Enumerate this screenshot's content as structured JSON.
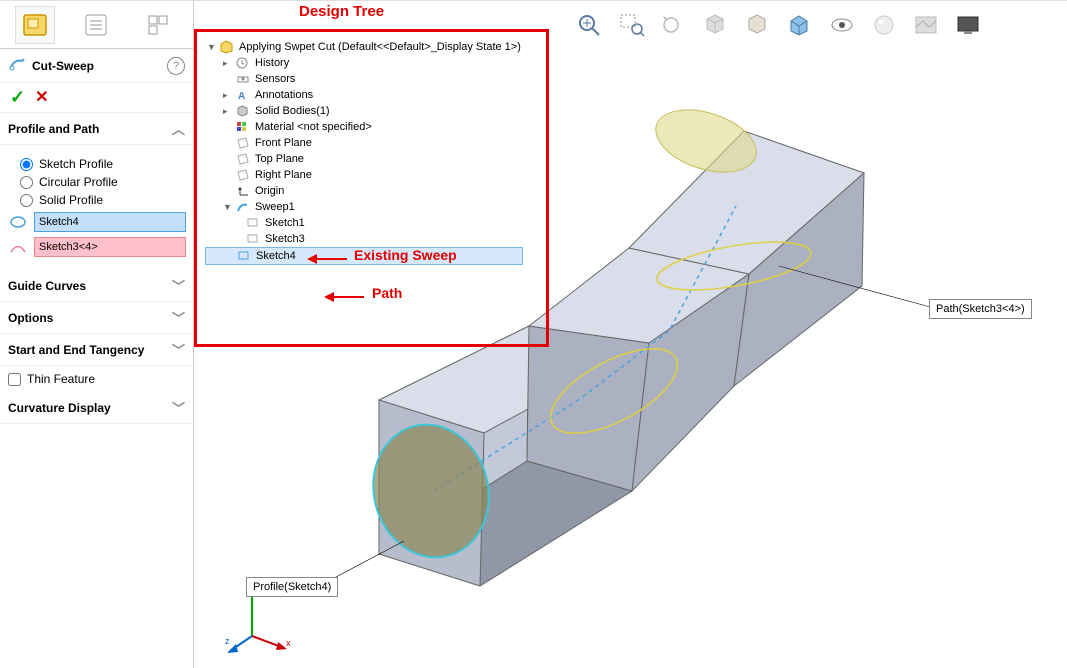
{
  "feature_manager": {
    "title": "Cut-Sweep",
    "help": "?",
    "actions": {
      "ok": "✓",
      "cancel": "✕"
    },
    "profile_path": {
      "header": "Profile and Path",
      "opt_sketch": "Sketch Profile",
      "opt_circular": "Circular Profile",
      "opt_solid": "Solid Profile",
      "profile_field": "Sketch4",
      "path_field": "Sketch3<4>"
    },
    "guide_curves": "Guide Curves",
    "options": "Options",
    "tangency": "Start and End Tangency",
    "thin_feature": "Thin Feature",
    "curvature": "Curvature Display"
  },
  "annotations": {
    "design_tree": "Design Tree",
    "existing_sweep": "Existing Sweep",
    "path": "Path"
  },
  "tree": {
    "root": "Applying Swpet Cut  (Default<<Default>_Display State 1>)",
    "history": "History",
    "sensors": "Sensors",
    "annotations": "Annotations",
    "solid_bodies": "Solid Bodies(1)",
    "material": "Material <not specified>",
    "front_plane": "Front Plane",
    "top_plane": "Top Plane",
    "right_plane": "Right Plane",
    "origin": "Origin",
    "sweep1": "Sweep1",
    "sketch1": "Sketch1",
    "sketch3": "Sketch3",
    "sketch4": "Sketch4"
  },
  "labels": {
    "path_callout": "Path(Sketch3<4>)",
    "profile_callout": "Profile(Sketch4)"
  }
}
